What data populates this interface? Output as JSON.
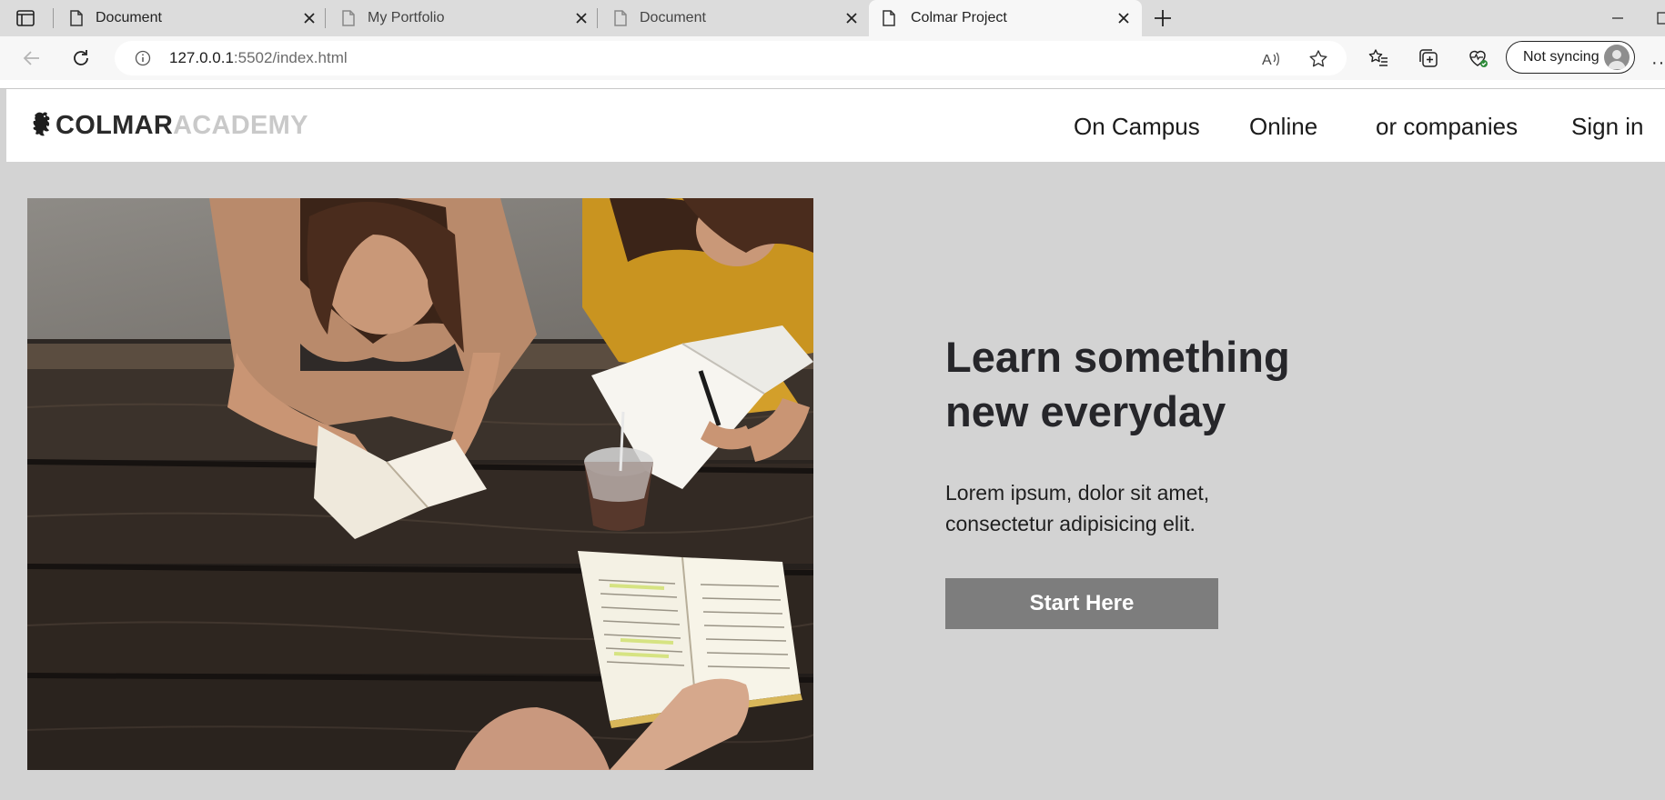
{
  "browser": {
    "tabs": [
      {
        "title": "Document",
        "active": false
      },
      {
        "title": "My Portfolio",
        "active": false
      },
      {
        "title": "Document",
        "active": false
      },
      {
        "title": "Colmar Project",
        "active": true
      }
    ],
    "url_host": "127.0.0.1",
    "url_rest": ":5502/index.html",
    "profile_label": "Not syncing"
  },
  "site": {
    "logo_part1": "COLMAR",
    "logo_part2": "ACADEMY",
    "nav": [
      "On Campus",
      "Online",
      "or companies",
      "Sign in"
    ]
  },
  "hero": {
    "title_line1": "Learn something",
    "title_line2": "new everyday",
    "text_line1": "Lorem ipsum, dolor sit amet,",
    "text_line2": "consectetur adipisicing elit.",
    "button": "Start Here"
  },
  "colors": {
    "page_bg": "#d3d3d3",
    "button_bg": "#7d7d7d",
    "logo_dim": "#c9c9c9"
  }
}
